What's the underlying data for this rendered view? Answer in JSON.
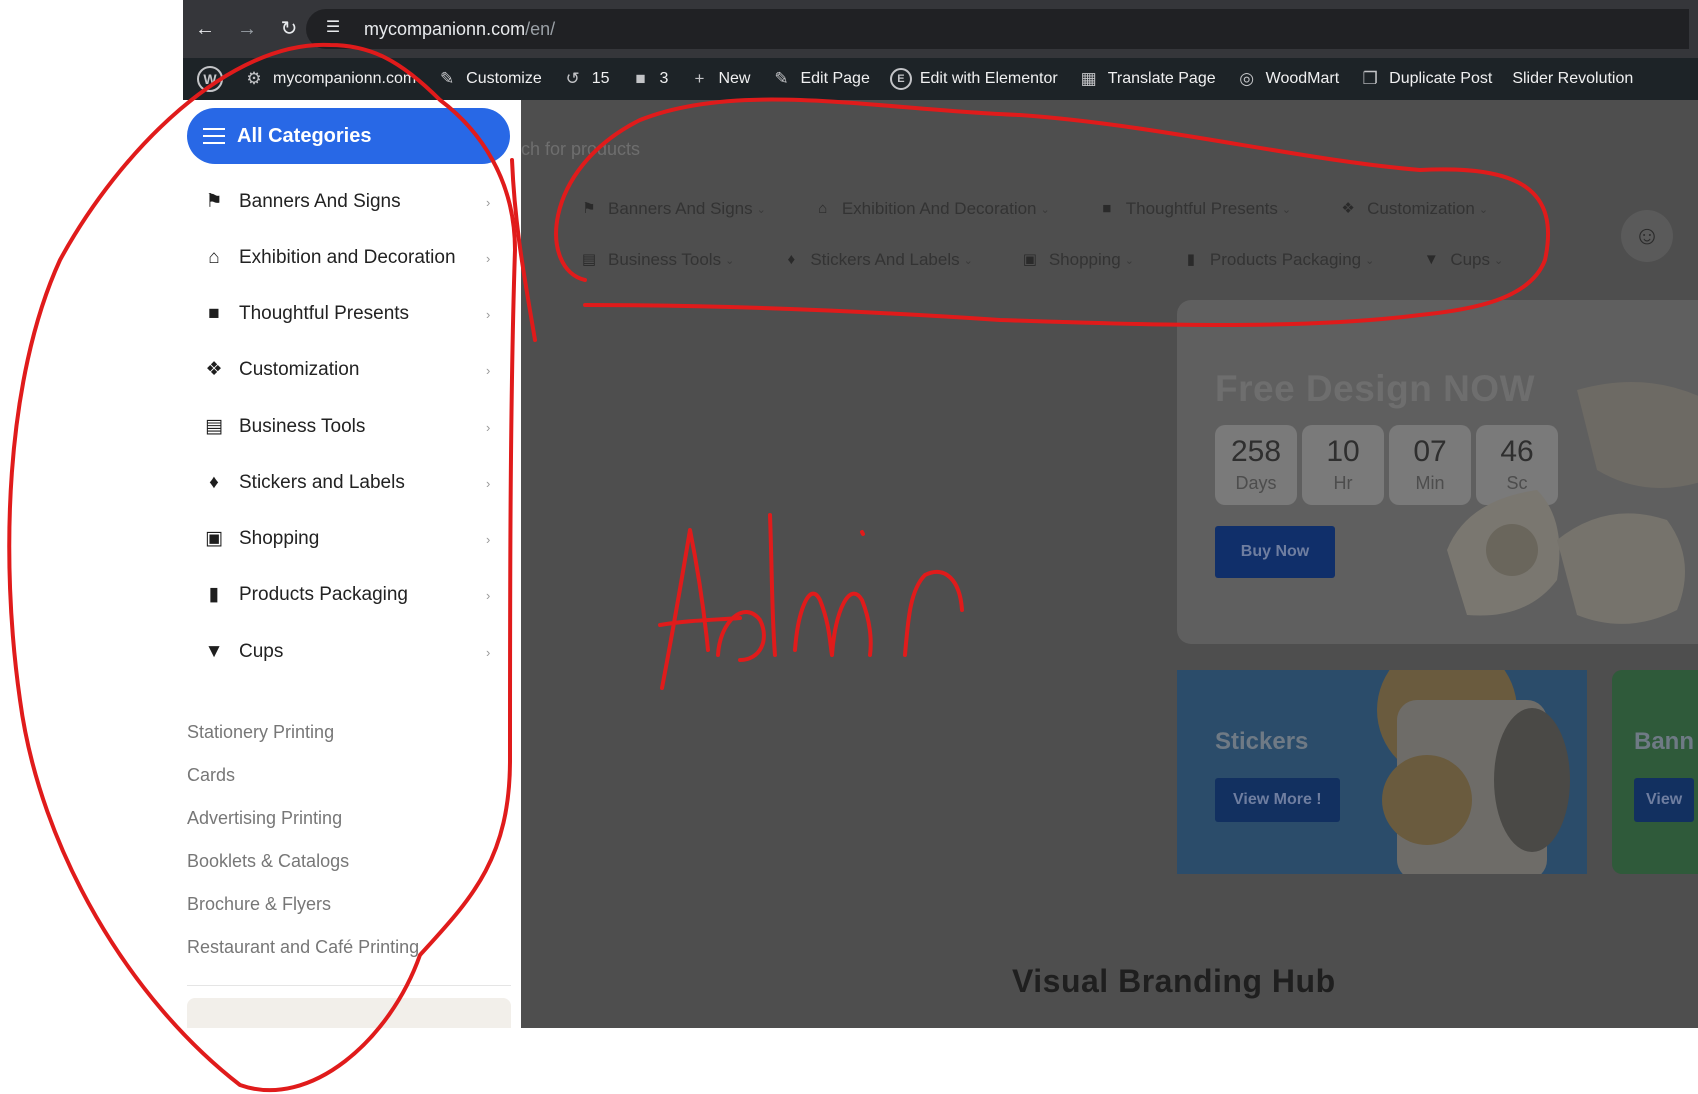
{
  "browser": {
    "url_domain": "mycompanionn.com",
    "url_path": "/en/",
    "icons": [
      "arrow-left-icon",
      "arrow-right-icon",
      "reload-icon",
      "site-info-icon"
    ]
  },
  "admin_bar": {
    "site_name": "mycompanionn.com",
    "customize": "Customize",
    "updates_count": "15",
    "comments_count": "3",
    "new": "New",
    "edit_page": "Edit Page",
    "edit_elementor": "Edit with Elementor",
    "translate_page": "Translate Page",
    "woodmart": "WoodMart",
    "duplicate_post": "Duplicate Post",
    "slider_revolution": "Slider Revolution"
  },
  "search": {
    "placeholder_fragment": "ch for products"
  },
  "top_menu": {
    "row1": [
      "Banners And Signs",
      "Exhibition And Decoration",
      "Thoughtful Presents",
      "Customization"
    ],
    "row2": [
      "Business Tools",
      "Stickers And Labels",
      "Shopping",
      "Products Packaging",
      "Cups"
    ]
  },
  "sidebar": {
    "all_categories": "All Categories",
    "categories": [
      {
        "label": "Banners And Signs",
        "icon": "sign-icon"
      },
      {
        "label": "Exhibition and Decoration",
        "icon": "booth-icon"
      },
      {
        "label": "Thoughtful Presents",
        "icon": "tshirt-icon"
      },
      {
        "label": "Customization",
        "icon": "box-icon"
      },
      {
        "label": "Business Tools",
        "icon": "document-icon"
      },
      {
        "label": "Stickers and Labels",
        "icon": "tag-icon"
      },
      {
        "label": "Shopping",
        "icon": "bag-icon"
      },
      {
        "label": "Products Packaging",
        "icon": "package-icon"
      },
      {
        "label": "Cups",
        "icon": "cup-icon"
      }
    ],
    "links": [
      "Stationery Printing",
      "Cards",
      "Advertising Printing",
      "Booklets & Catalogs",
      "Brochure & Flyers",
      "Restaurant and Café Printing"
    ]
  },
  "hero": {
    "title": "Free Design NOW",
    "countdown": [
      {
        "value": "258",
        "label": "Days"
      },
      {
        "value": "10",
        "label": "Hr"
      },
      {
        "value": "07",
        "label": "Min"
      },
      {
        "value": "46",
        "label": "Sc"
      }
    ],
    "button": "Buy Now"
  },
  "promos": {
    "stickers_title": "Stickers",
    "stickers_button": "View More !",
    "banners_title": "Bann",
    "banners_button": "View"
  },
  "section_title": "Visual Branding Hub",
  "annotation": {
    "handwritten_text": "Admin",
    "color": "#e01b1b"
  },
  "colors": {
    "accent": "#2868e6",
    "admin_bar": "#1d2327",
    "browser": "#35363a"
  }
}
